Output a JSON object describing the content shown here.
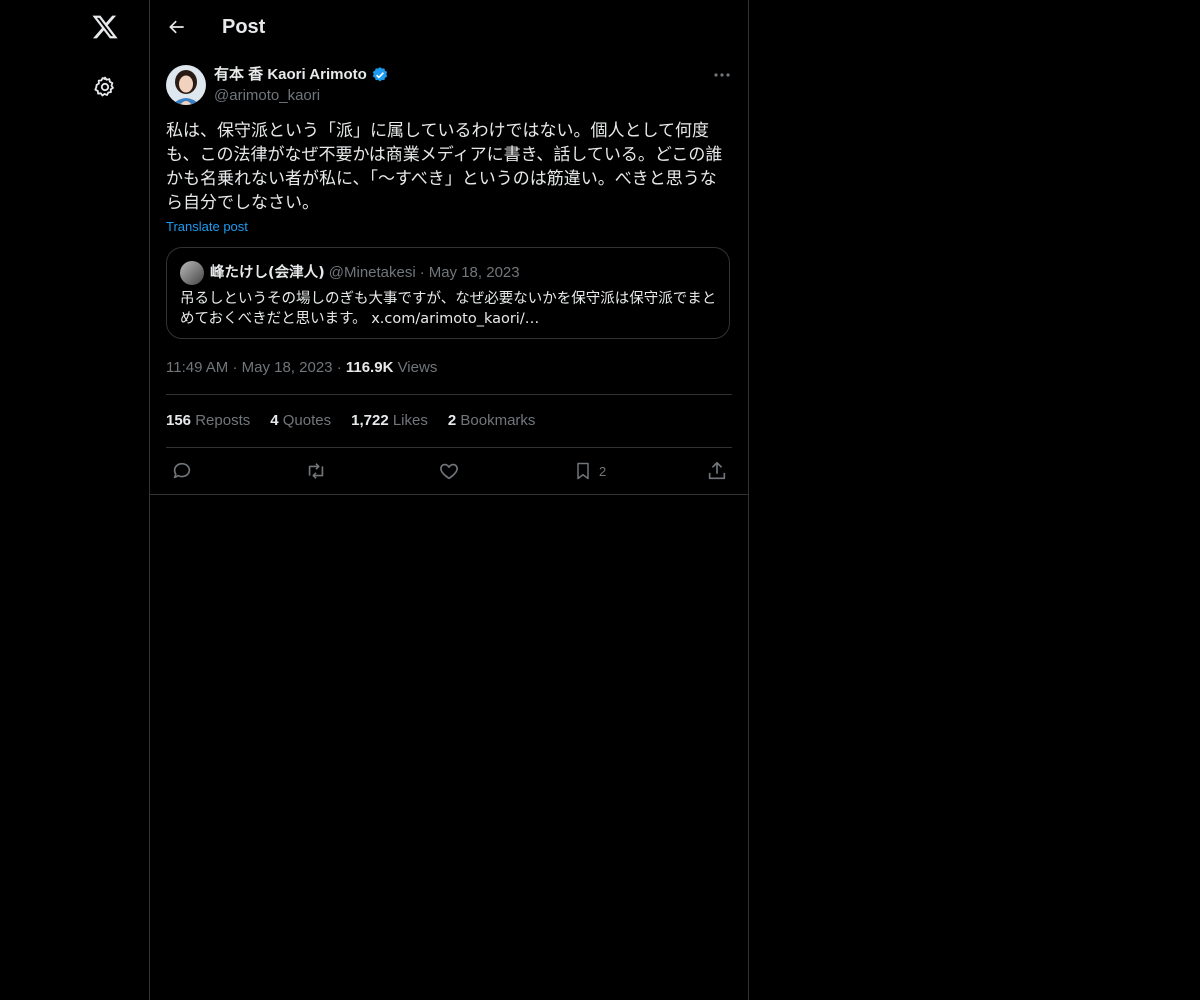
{
  "header": {
    "title": "Post"
  },
  "post": {
    "author_name": "有本 香 Kaori Arimoto",
    "handle": "@arimoto_kaori",
    "text": "私は、保守派という「派」に属しているわけではない。個人として何度\nも、この法律がなぜ不要かは商業メディアに書き、話している。どこの誰\nかも名乗れない者が私に、「〜すべき」というのは筋違い。べきと思うな\nら自分でしなさい。",
    "translate_label": "Translate post",
    "quote": {
      "author_name": "峰たけし(会津人)",
      "handle": "@Minetakesi",
      "separator": "·",
      "date": "May 18, 2023",
      "text": "吊るしというその場しのぎも大事ですが、なぜ必要ないかを保守派は保守派でまとめておくべきだと思います。 x.com/arimoto_kaori/…"
    },
    "time": "11:49 AM",
    "date": "May 18, 2023",
    "separator": "·",
    "views_count": "116.9K",
    "views_label": "Views"
  },
  "stats": {
    "reposts_count": "156",
    "reposts_label": "Reposts",
    "quotes_count": "4",
    "quotes_label": "Quotes",
    "likes_count": "1,722",
    "likes_label": "Likes",
    "bookmarks_count": "2",
    "bookmarks_label": "Bookmarks"
  },
  "actions": {
    "bookmark_count": "2"
  },
  "icons": {
    "logo": "x-logo-icon",
    "settings": "gear-icon",
    "back": "back-arrow-icon",
    "verified": "verified-badge-icon",
    "more": "more-icon",
    "reply": "reply-icon",
    "repost": "repost-icon",
    "like": "like-icon",
    "bookmark": "bookmark-icon",
    "share": "share-icon"
  },
  "colors": {
    "accent": "#1d9bf0",
    "background": "#000000",
    "muted": "#71767b",
    "border": "#2f3336"
  }
}
